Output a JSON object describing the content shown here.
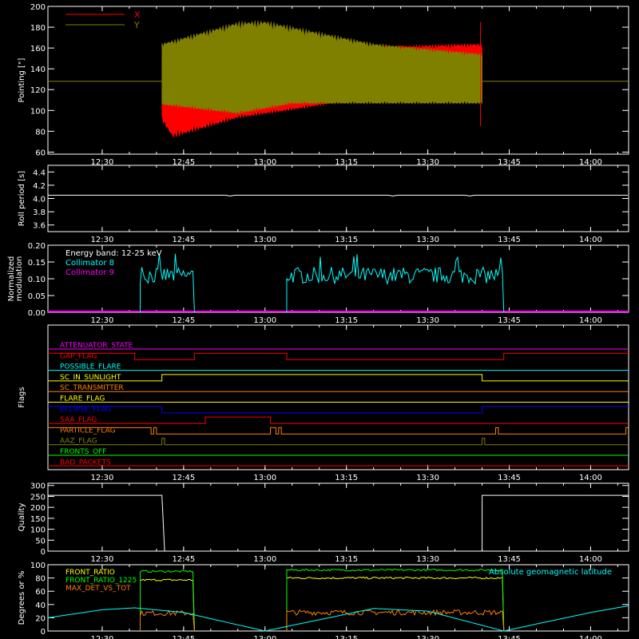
{
  "time_ticks": [
    "12:30",
    "12:45",
    "13:00",
    "13:15",
    "13:30",
    "13:45",
    "14:00"
  ],
  "chart_data": [
    {
      "type": "line",
      "ylabel": "Pointing [\"]",
      "ylim": [
        58,
        200
      ],
      "yticks": [
        "60",
        "80",
        "100",
        "120",
        "140",
        "160",
        "180",
        "200"
      ],
      "legend": [
        {
          "name": "X",
          "color": "#ff0000"
        },
        {
          "name": "Y",
          "color": "#808000"
        }
      ],
      "x_range": [
        "12:20",
        "14:07"
      ],
      "series": [
        {
          "name": "X",
          "color": "#ff0000",
          "mean": 128,
          "upper": [
            {
              "t": "12:41",
              "v": 150
            },
            {
              "t": "12:55",
              "v": 158
            },
            {
              "t": "13:05",
              "v": 160
            },
            {
              "t": "13:20",
              "v": 162
            },
            {
              "t": "13:40",
              "v": 165
            }
          ],
          "lower": [
            {
              "t": "12:41",
              "v": 90
            },
            {
              "t": "12:43",
              "v": 73
            },
            {
              "t": "12:55",
              "v": 92
            },
            {
              "t": "13:05",
              "v": 100
            },
            {
              "t": "13:20",
              "v": 113
            },
            {
              "t": "13:40",
              "v": 117
            }
          ]
        },
        {
          "name": "Y",
          "color": "#808000",
          "mean": 128,
          "upper": [
            {
              "t": "12:41",
              "v": 165
            },
            {
              "t": "12:55",
              "v": 186
            },
            {
              "t": "13:00",
              "v": 187
            },
            {
              "t": "13:20",
              "v": 165
            },
            {
              "t": "13:40",
              "v": 155
            }
          ],
          "lower": [
            {
              "t": "12:41",
              "v": 105
            },
            {
              "t": "12:55",
              "v": 96
            },
            {
              "t": "13:05",
              "v": 106
            },
            {
              "t": "13:20",
              "v": 106
            },
            {
              "t": "13:40",
              "v": 106
            }
          ]
        }
      ]
    },
    {
      "type": "line",
      "ylabel": "Roll period [s]",
      "ylim": [
        3.5,
        4.5
      ],
      "yticks": [
        "3.6",
        "3.8",
        "4.0",
        "4.2",
        "4.4"
      ],
      "series": [
        {
          "color": "#ffffff",
          "values": [
            {
              "t": "12:20",
              "v": 4.05
            },
            {
              "t": "14:07",
              "v": 4.05
            }
          ]
        }
      ]
    },
    {
      "type": "line",
      "ylabel_lines": [
        "Normalized",
        "modulation"
      ],
      "ylim": [
        0,
        0.2
      ],
      "yticks": [
        "0.00",
        "0.05",
        "0.10",
        "0.15",
        "0.20"
      ],
      "annotation": "Energy band: 12-25 keV",
      "legend": [
        {
          "name": "Collimator 8",
          "color": "#00ffff"
        },
        {
          "name": "Collimator 9",
          "color": "#ff00ff"
        }
      ],
      "segments": [
        {
          "series": "Collimator 8",
          "start": "12:37",
          "end": "12:47",
          "level": 0.11
        },
        {
          "series": "Collimator 8",
          "start": "13:04",
          "end": "13:44",
          "level": 0.11
        }
      ]
    },
    {
      "type": "line",
      "ylabel": "Flags",
      "flags": [
        {
          "name": "ATTENUATOR_STATE",
          "color": "#ff00ff",
          "high": []
        },
        {
          "name": "GAP_FLAG",
          "color": "#ff0000",
          "high": [
            [
              "12:20",
              "12:36"
            ],
            [
              "12:47",
              "13:04"
            ],
            [
              "13:44",
              "14:07"
            ]
          ]
        },
        {
          "name": "POSSIBLE_FLARE",
          "color": "#00ffff",
          "high": []
        },
        {
          "name": "SC_IN_SUNLIGHT",
          "color": "#ffff00",
          "high": [
            [
              "12:41",
              "13:40"
            ]
          ]
        },
        {
          "name": "SC_TRANSMITTER",
          "color": "#ff8000",
          "high": []
        },
        {
          "name": "FLARE_FLAG",
          "color": "#ffff00",
          "high": []
        },
        {
          "name": "ECLIPSE_FLAG",
          "color": "#0000ff",
          "high": [
            [
              "12:20",
              "12:41"
            ],
            [
              "13:40",
              "14:07"
            ]
          ]
        },
        {
          "name": "SAA_FLAG",
          "color": "#ff0000",
          "high": [
            [
              "12:49",
              "13:01"
            ]
          ]
        },
        {
          "name": "PARTICLE_FLAG",
          "color": "#ff8000",
          "high": [
            [
              "12:20",
              "12:39"
            ],
            [
              "12:39.5",
              "12:40"
            ],
            [
              "13:01",
              "13:02"
            ],
            [
              "13:02.5",
              "13:03"
            ],
            [
              "13:42.5",
              "13:43"
            ],
            [
              "14:06.5",
              "14:07"
            ]
          ]
        },
        {
          "name": "AAZ_FLAG",
          "color": "#808000",
          "high": [
            [
              "12:41",
              "12:41.5"
            ],
            [
              "13:40",
              "13:40.5"
            ]
          ]
        },
        {
          "name": "FRONTS_OFF",
          "color": "#00ff00",
          "high": []
        },
        {
          "name": "BAD_PACKETS",
          "color": "#ff0000",
          "high": []
        }
      ]
    },
    {
      "type": "line",
      "ylabel": "Quality",
      "ylim": [
        0,
        310
      ],
      "yticks": [
        "0",
        "50",
        "100",
        "150",
        "200",
        "250",
        "300"
      ],
      "series": [
        {
          "color": "#ffffff",
          "values": [
            {
              "t": "12:20",
              "v": 255
            },
            {
              "t": "12:41",
              "v": 255
            },
            {
              "t": "12:41.5",
              "v": 0
            },
            {
              "t": "13:40",
              "v": 0
            },
            {
              "t": "13:40",
              "v": 255
            },
            {
              "t": "14:07",
              "v": 255
            }
          ]
        }
      ]
    },
    {
      "type": "line",
      "ylabel": "Degrees or %",
      "ylim": [
        0,
        100
      ],
      "yticks": [
        "0",
        "20",
        "40",
        "60",
        "80",
        "100"
      ],
      "legend": [
        {
          "name": "FRONT_RATIO",
          "color": "#ffff00"
        },
        {
          "name": "FRONT_RATIO_1225",
          "color": "#00ff00"
        },
        {
          "name": "MAX_DET_VS_TOT",
          "color": "#ff8000"
        }
      ],
      "right_label": {
        "text": "Absolute geomagnetic latitude",
        "color": "#00ffff"
      },
      "series": [
        {
          "name": "FRONT_RATIO",
          "color": "#ffff00",
          "segments": [
            {
              "start": "12:37",
              "end": "12:47",
              "level": 77
            },
            {
              "start": "13:04",
              "end": "13:44",
              "level": 80
            }
          ]
        },
        {
          "name": "FRONT_RATIO_1225",
          "color": "#00ff00",
          "segments": [
            {
              "start": "12:37",
              "end": "12:47",
              "level": 90
            },
            {
              "start": "13:04",
              "end": "13:44",
              "level": 92
            }
          ]
        },
        {
          "name": "MAX_DET_VS_TOT",
          "color": "#ff8000",
          "segments": [
            {
              "start": "12:37",
              "end": "12:47",
              "level": 27
            },
            {
              "start": "13:04",
              "end": "13:44",
              "level": 28
            }
          ]
        },
        {
          "name": "Absolute geomagnetic latitude",
          "color": "#00ffff",
          "values": [
            {
              "t": "12:20",
              "v": 20
            },
            {
              "t": "12:30",
              "v": 32
            },
            {
              "t": "12:36",
              "v": 35
            },
            {
              "t": "12:45",
              "v": 28
            },
            {
              "t": "13:00",
              "v": 0
            },
            {
              "t": "13:20",
              "v": 34
            },
            {
              "t": "13:30",
              "v": 30
            },
            {
              "t": "13:44",
              "v": 0
            },
            {
              "t": "14:00",
              "v": 28
            },
            {
              "t": "14:07",
              "v": 38
            }
          ]
        }
      ]
    }
  ]
}
